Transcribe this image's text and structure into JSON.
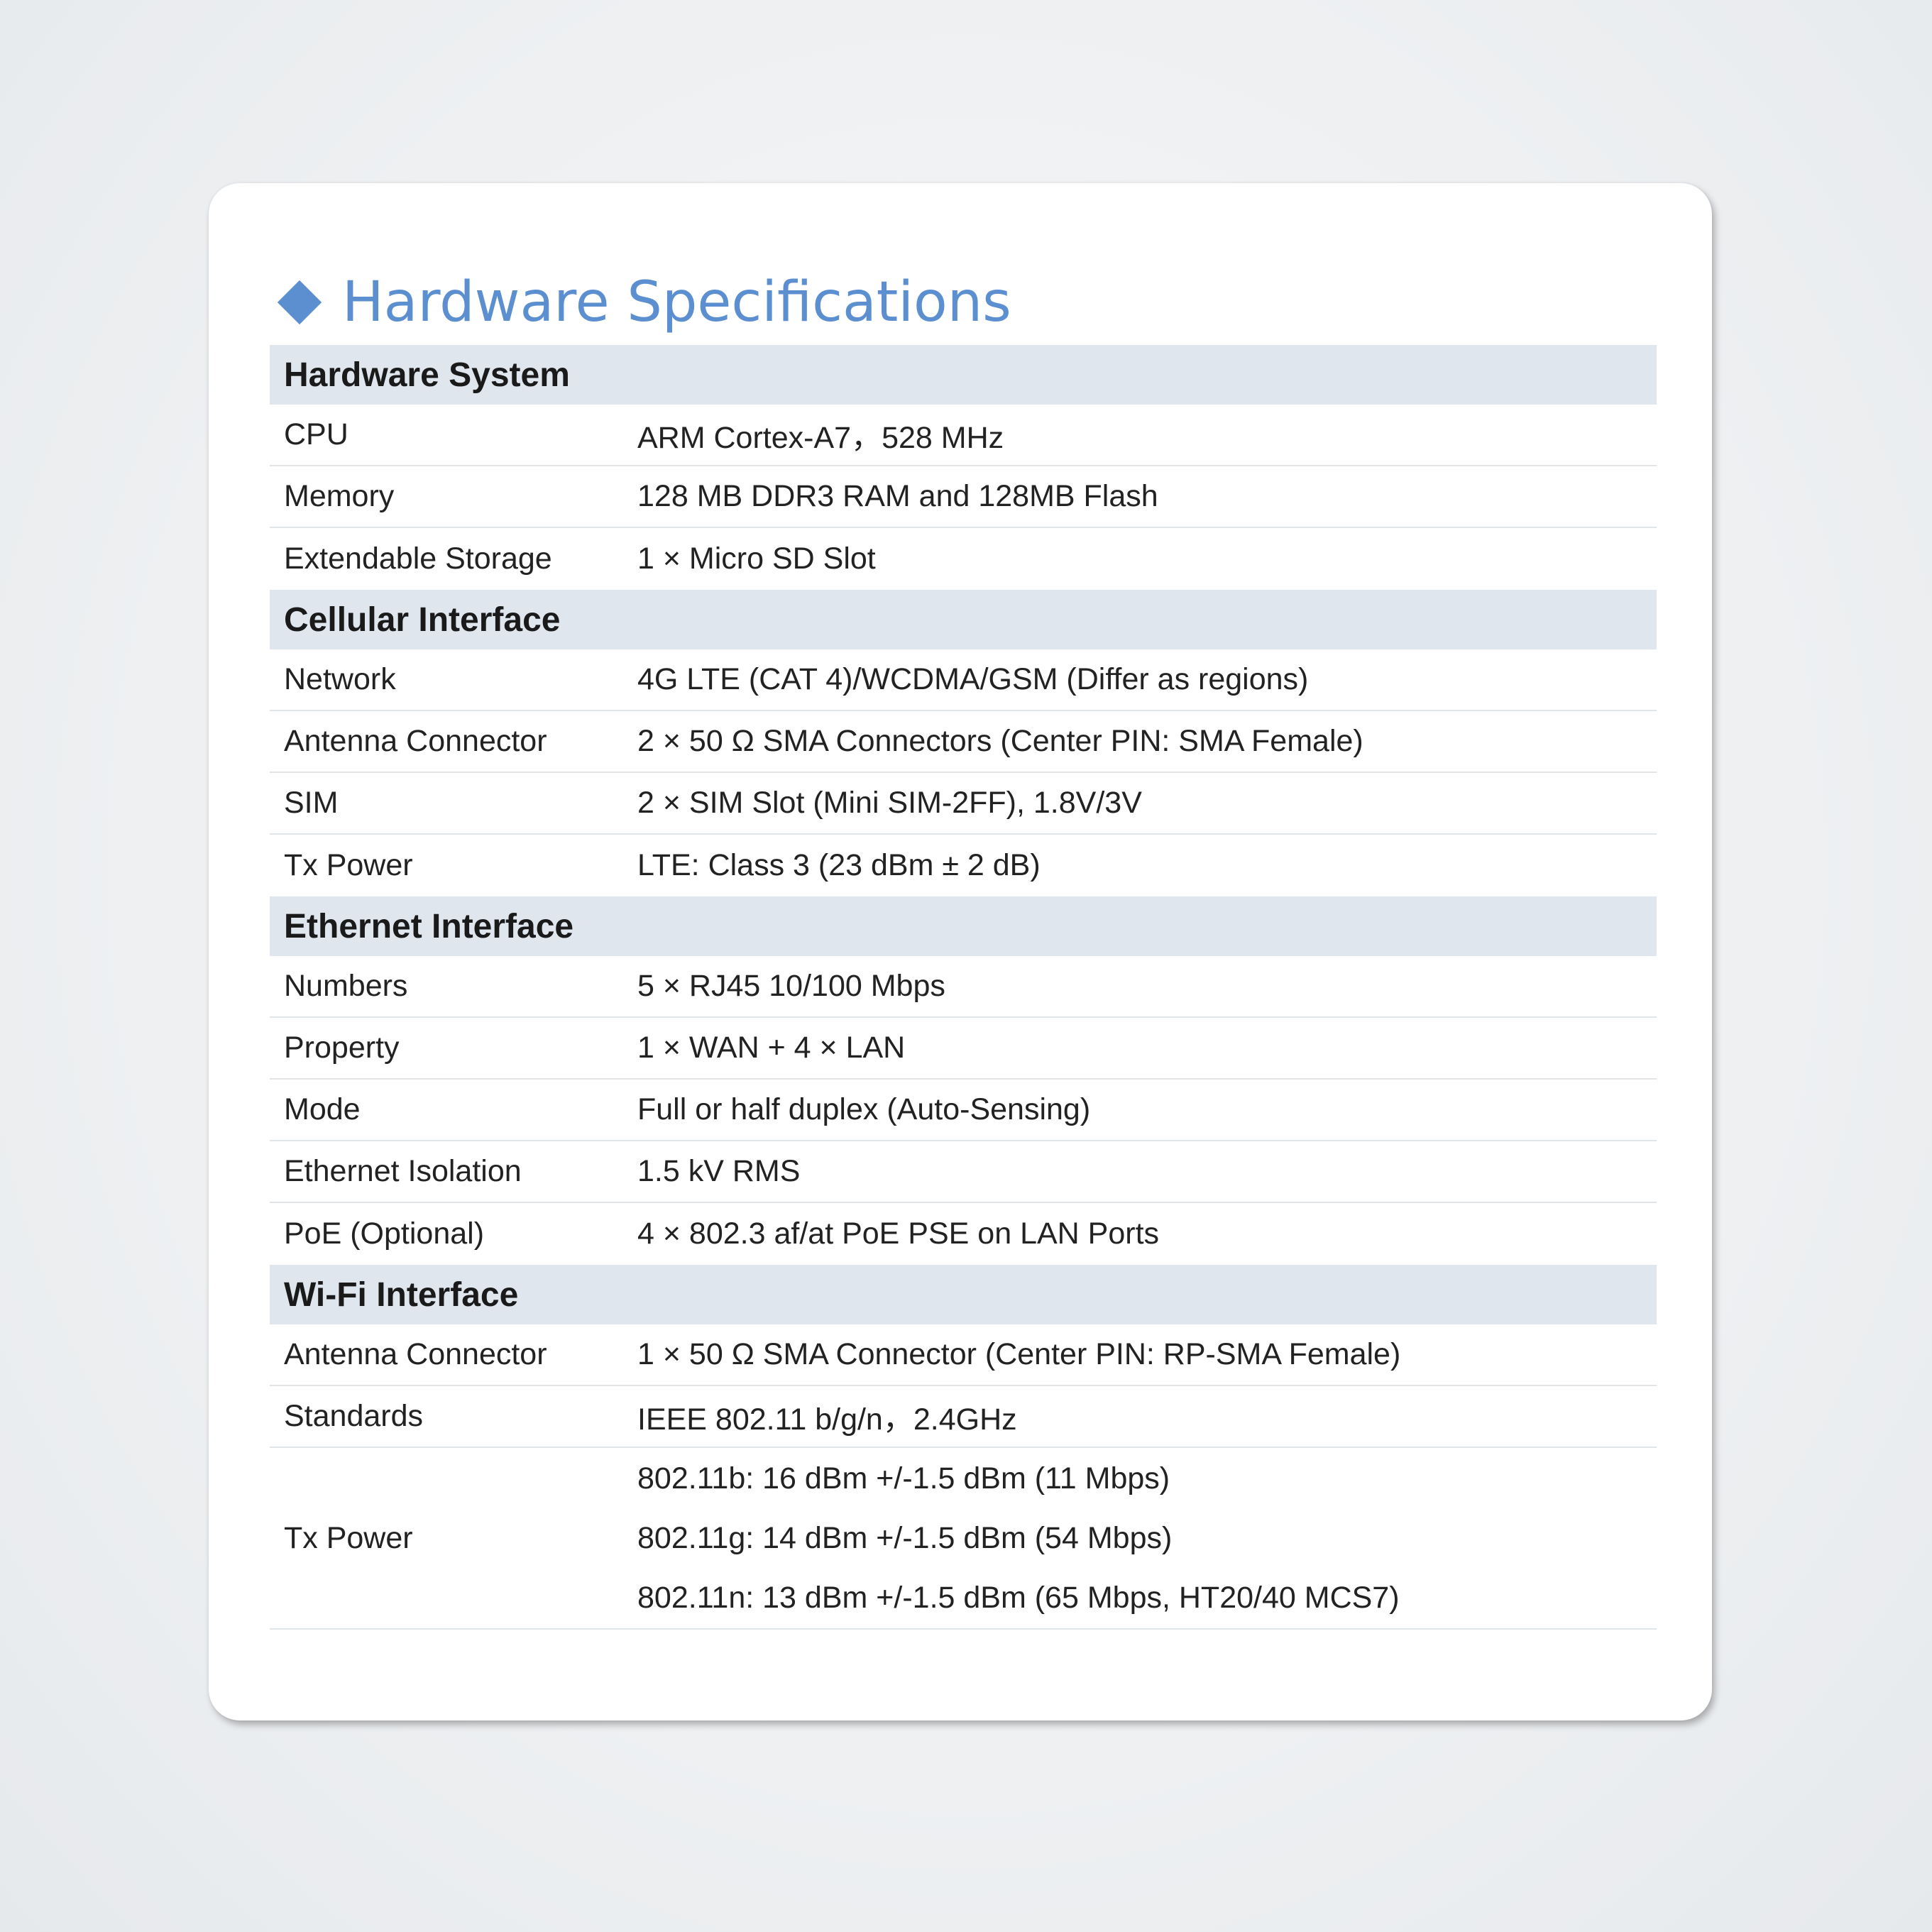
{
  "title": "Hardware Specifications",
  "sections": [
    {
      "header": "Hardware System",
      "rows": [
        {
          "label": "CPU",
          "value": "ARM Cortex-A7，528 MHz"
        },
        {
          "label": "Memory",
          "value": "128 MB DDR3 RAM and 128MB Flash"
        },
        {
          "label": "Extendable Storage",
          "value": "1 × Micro SD Slot"
        }
      ]
    },
    {
      "header": "Cellular Interface",
      "rows": [
        {
          "label": "Network",
          "value": "4G LTE (CAT 4)/WCDMA/GSM (Differ as regions)"
        },
        {
          "label": "Antenna Connector",
          "value": "2 × 50 Ω SMA Connectors (Center PIN: SMA Female)"
        },
        {
          "label": "SIM",
          "value": "2 × SIM Slot (Mini SIM-2FF), 1.8V/3V"
        },
        {
          "label": "Tx Power",
          "value": "LTE: Class 3 (23 dBm ± 2 dB)"
        }
      ]
    },
    {
      "header": "Ethernet Interface",
      "rows": [
        {
          "label": "Numbers",
          "value": "5 × RJ45 10/100 Mbps"
        },
        {
          "label": "Property",
          "value": "1 × WAN + 4 × LAN"
        },
        {
          "label": "Mode",
          "value": "Full or half duplex (Auto-Sensing)"
        },
        {
          "label": "Ethernet Isolation",
          "value": "1.5 kV RMS"
        },
        {
          "label": "PoE (Optional)",
          "value": "4 × 802.3 af/at PoE PSE on LAN Ports"
        }
      ]
    },
    {
      "header": "Wi-Fi Interface",
      "rows": [
        {
          "label": "Antenna Connector",
          "value": "1 × 50 Ω SMA Connector (Center PIN: RP-SMA Female)"
        },
        {
          "label": "Standards",
          "value": "IEEE 802.11 b/g/n，2.4GHz"
        }
      ],
      "tx_power": {
        "label": "Tx Power",
        "values": [
          "802.11b: 16 dBm +/-1.5 dBm (11 Mbps)",
          "802.11g: 14 dBm +/-1.5 dBm (54 Mbps)",
          "802.11n: 13 dBm +/-1.5 dBm (65 Mbps, HT20/40 MCS7)"
        ]
      }
    }
  ],
  "colors": {
    "accent": "#5b8fd0",
    "section_header_bg": "#dfe6ed",
    "row_divider": "#e2e5e8"
  },
  "icons": {
    "title_bullet": "diamond-icon"
  }
}
